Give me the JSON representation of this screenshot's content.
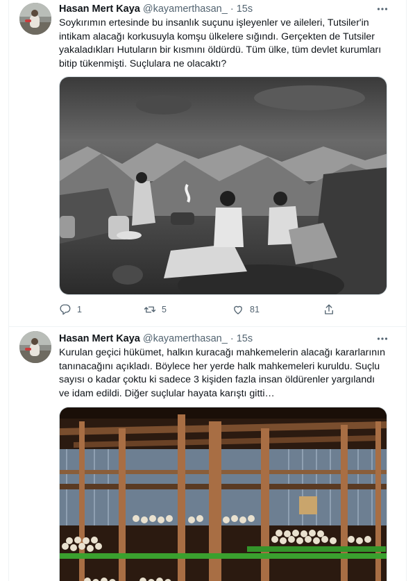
{
  "tweets": [
    {
      "author_name": "Hasan Mert Kaya",
      "handle": "@kayamerthasan_",
      "separator": "·",
      "time": "15s",
      "text": "Soykırımın ertesinde bu insanlık suçunu işleyenler ve aileleri, Tutsiler'in intikam alacağı korkusuyla komşu ülkelere sığındı. Gerçekten de Tutsiler yakaladıkları Hutuların bir kısmını öldürdü. Tüm ülke, tüm devlet kurumları bitip tükenmişti. Suçlulara ne olacaktı?",
      "replies": "1",
      "retweets": "5",
      "likes": "81"
    },
    {
      "author_name": "Hasan Mert Kaya",
      "handle": "@kayamerthasan_",
      "separator": "·",
      "time": "15s",
      "text": "Kurulan geçici hükümet, halkın kuracağı mahkemelerin alacağı kararlarının tanınacağını açıkladı. Böylece her yerde halk mahkemeleri kuruldu. Suçlu sayısı o kadar çoktu ki sadece 3 kişiden fazla insan öldürenler yargılandı ve idam edildi. Diğer suçlular hayata karıştı gitti…"
    }
  ],
  "icons": {
    "more": "more-icon",
    "reply": "reply-icon",
    "retweet": "retweet-icon",
    "like": "like-icon",
    "share": "share-icon"
  },
  "colors": {
    "text": "#0f1419",
    "secondary": "#536471",
    "border": "#cfd9de"
  }
}
